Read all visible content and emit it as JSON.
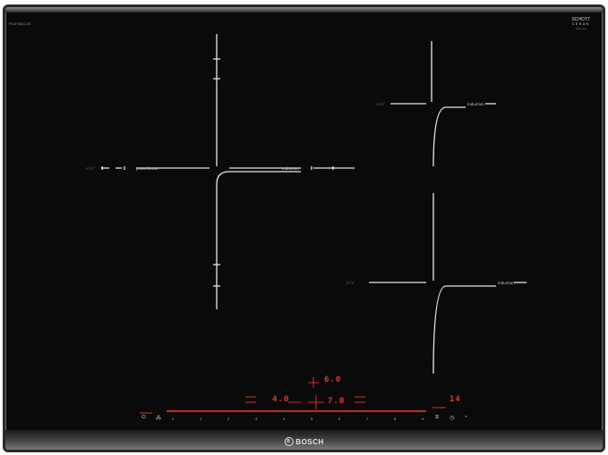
{
  "model_number": "PXZ75DC1E",
  "schott": {
    "line1": "SCHOTT",
    "line2": "CERAN",
    "line3": "ceran·com"
  },
  "zones": {
    "left_label_a": "powerboost",
    "left_label_b": "induction",
    "right_top_label": "induction",
    "right_bottom_label": "induction"
  },
  "displays": {
    "top": "6.0",
    "left": "4.0",
    "middle": "7.0",
    "timer": "14"
  },
  "slider_numbers": [
    "0",
    "1",
    "2",
    "3",
    "4",
    "5",
    "6",
    "7",
    "8",
    "9"
  ],
  "brand": {
    "logo": "B",
    "name": "BOSCH"
  },
  "colors": {
    "glass": "#0a0a0b",
    "accent": "#e03a2a"
  }
}
